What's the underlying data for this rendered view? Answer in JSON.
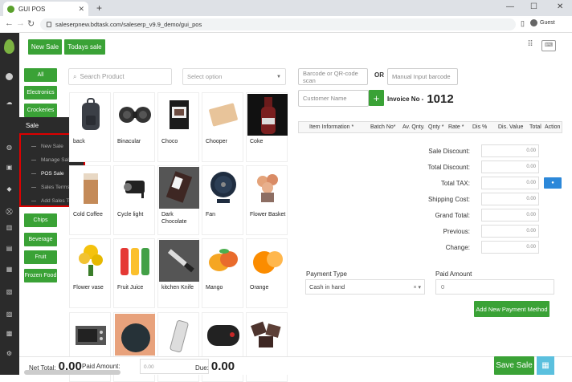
{
  "browser": {
    "tab_title": "GUI POS",
    "url": "saleserpnew.bdtask.com/saleserp_v9.9_demo/gui_pos",
    "profile": "Guest"
  },
  "menu": {
    "sale_label": "Sale",
    "submenu": [
      "New Sale",
      "Manage Sale",
      "POS Sale",
      "Sales Terms List",
      "Add Sales Terms"
    ]
  },
  "top": {
    "new_sale": "New Sale",
    "todays_sale": "Todays sale"
  },
  "categories": [
    "All",
    "Electronics",
    "Crockeries",
    "Chips",
    "Beverage",
    "Fruit",
    "Frozen Food"
  ],
  "search": {
    "placeholder": "Search Product"
  },
  "select_option": "Select option",
  "products": [
    {
      "name": "back",
      "icon": "backpack-icon"
    },
    {
      "name": "Binacular",
      "icon": "binocular-icon"
    },
    {
      "name": "Choco",
      "icon": "chocolate-icon"
    },
    {
      "name": "Chooper",
      "icon": "chopper-icon"
    },
    {
      "name": "Coke",
      "icon": "bottle-icon"
    },
    {
      "name": "Cold Coffee",
      "icon": "coffee-icon"
    },
    {
      "name": "Cycle light",
      "icon": "cycle-light-icon"
    },
    {
      "name": "Dark Chocolate",
      "icon": "dark-chocolate-icon"
    },
    {
      "name": "Fan",
      "icon": "fan-icon"
    },
    {
      "name": "Flower Basket",
      "icon": "flower-basket-icon"
    },
    {
      "name": "Flower vase",
      "icon": "flower-vase-icon"
    },
    {
      "name": "Fruit Juice",
      "icon": "juice-icon"
    },
    {
      "name": "kitchen Knife",
      "icon": "knife-icon"
    },
    {
      "name": "Mango",
      "icon": "mango-icon"
    },
    {
      "name": "Orange",
      "icon": "orange-icon"
    },
    {
      "name": "",
      "icon": "oven-icon"
    },
    {
      "name": "",
      "icon": "pan-icon"
    },
    {
      "name": "",
      "icon": "phone-icon"
    },
    {
      "name": "",
      "icon": "speaker-icon"
    },
    {
      "name": "",
      "icon": "chocolate-pieces-icon"
    }
  ],
  "barcode": {
    "placeholder": "Barcode or QR-code scan",
    "or": "OR",
    "manual": "Manual Input barcode"
  },
  "customer": {
    "placeholder": "Customer Name",
    "add": "+"
  },
  "invoice": {
    "label": "Invoice No -",
    "number": "1012"
  },
  "table_headers": [
    "Item Information *",
    "Batch No*",
    "Av. Qnty.",
    "Qnty *",
    "Rate *",
    "Dis %",
    "Dis. Value",
    "Total",
    "Action"
  ],
  "summary": [
    {
      "label": "Sale Discount:",
      "value": "0.00"
    },
    {
      "label": "Total Discount:",
      "value": "0.00"
    },
    {
      "label": "Total TAX:",
      "value": "0.00"
    },
    {
      "label": "Shipping Cost:",
      "value": "0.00"
    },
    {
      "label": "Grand Total:",
      "value": "0.00"
    },
    {
      "label": "Previous:",
      "value": "0.00"
    },
    {
      "label": "Change:",
      "value": "0.00"
    }
  ],
  "payment": {
    "type_label": "Payment Type",
    "type_value": "Cash in hand",
    "clear": "×",
    "amount_label": "Paid Amount",
    "amount_value": "0",
    "add_method": "Add New Payment Method"
  },
  "footer": {
    "net_total_label": "Net Total:",
    "net_total": "0.00",
    "paid_label": "Paid Amount:",
    "paid_placeholder": "0.00",
    "due_label": "Due:",
    "due": "0.00",
    "save": "Save Sale"
  }
}
